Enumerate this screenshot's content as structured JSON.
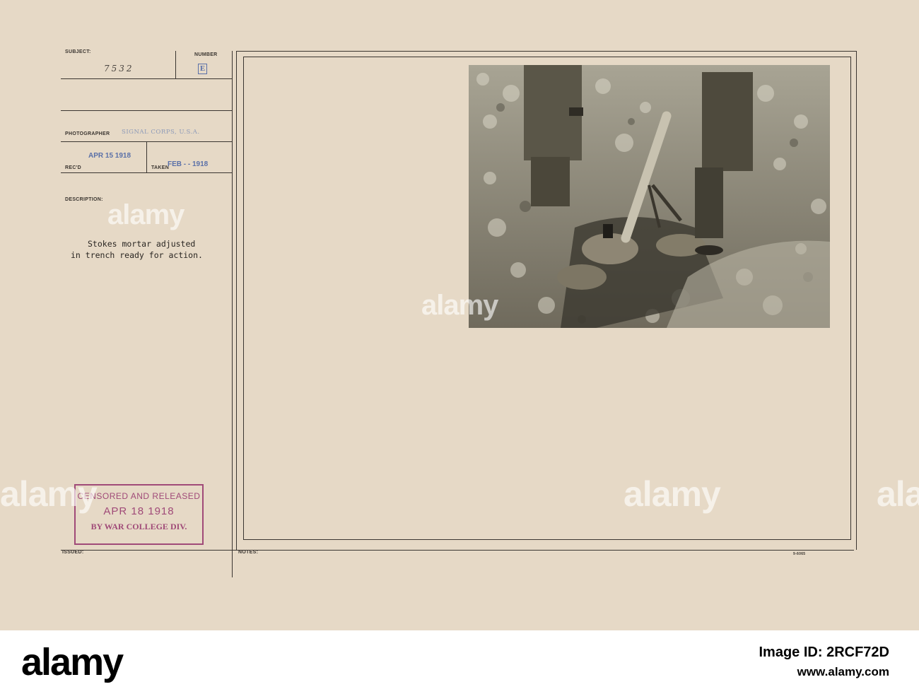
{
  "labels": {
    "subject": "SUBJECT:",
    "number": "NUMBER",
    "photographer": "PHOTOGRAPHER",
    "recd": "REC'D",
    "taken": "TAKEN",
    "description": "DESCRIPTION:",
    "issued": "ISSUED:",
    "notes": "NOTES:"
  },
  "subject_number": "7532",
  "number_letter": "E",
  "photographer": "SIGNAL CORPS, U.S.A.",
  "recd_date": "APR 15 1918",
  "taken_date": "FEB - - 1918",
  "description_lines": [
    "Stokes mortar adjusted",
    "in trench ready for action."
  ],
  "censor_stamp": {
    "line1": "CENSORED AND RELEASED",
    "line2": "APR 18 1918",
    "line3": "BY WAR COLLEGE DIV."
  },
  "form_code": "9-6065",
  "watermark": "alamy",
  "footer": {
    "logo": "alamy",
    "image_id_line": "Image ID: 2RCF72D",
    "url": "www.alamy.com"
  },
  "colors": {
    "card": "#e6d9c6",
    "stamp_blue": "#5a70a8",
    "censor_purple": "#a04a78"
  }
}
